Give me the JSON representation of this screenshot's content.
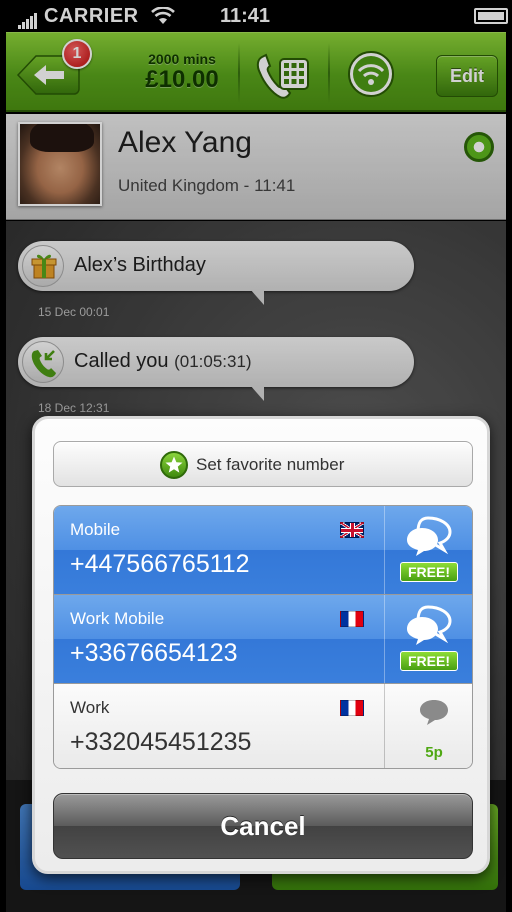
{
  "status_bar": {
    "carrier": "CARRIER",
    "time": "11:41"
  },
  "toolbar": {
    "badge_count": "1",
    "credit_minutes": "2000 mins",
    "credit_amount": "£10.00",
    "edit_label": "Edit",
    "accent_color": "#5aa51c"
  },
  "contact": {
    "name": "Alex Yang",
    "subtitle": "United Kingdom - 11:41",
    "online": true
  },
  "events": [
    {
      "icon": "gift-icon",
      "label": "Alex’s Birthday",
      "time": "15 Dec 00:01"
    },
    {
      "icon": "incoming-call-icon",
      "label": "Called you",
      "duration": "(01:05:31)",
      "time": "18 Dec 12:31"
    }
  ],
  "popup": {
    "favorite_label": "Set favorite number",
    "numbers": [
      {
        "type": "Mobile",
        "number": "+447566765112",
        "flag": "uk-flag",
        "badge": "FREE!",
        "selected": true
      },
      {
        "type": "Work Mobile",
        "number": "+33676654123",
        "flag": "fr-flag",
        "badge": "FREE!",
        "selected": true
      },
      {
        "type": "Work",
        "number": "+332045451235",
        "flag": "fr-flag",
        "price": "5p",
        "selected": false
      }
    ],
    "cancel_label": "Cancel"
  }
}
